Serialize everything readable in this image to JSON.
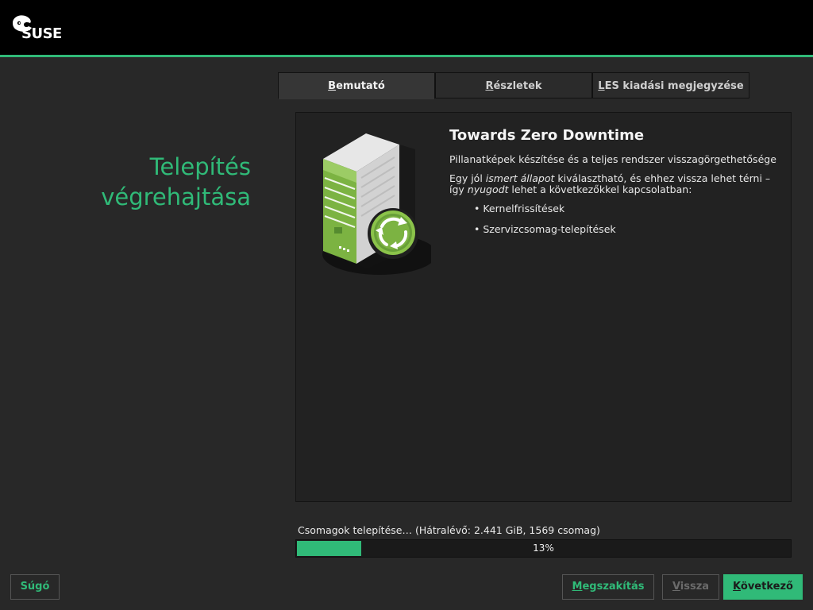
{
  "brand": {
    "logo_text": "SUSE",
    "accent": "#30ba78",
    "header_bg": "#000000"
  },
  "page": {
    "title": "Telepítés\nvégrehajtása"
  },
  "tabs": [
    {
      "mnemonic": "B",
      "rest": "emutató",
      "active": true
    },
    {
      "mnemonic": "R",
      "rest": "észletek",
      "active": false
    },
    {
      "mnemonic": "L",
      "rest": "ES kiadási megjegyzése",
      "active": false
    }
  ],
  "slide": {
    "icon": "server-icon",
    "title": "Towards Zero Downtime",
    "paragraph1": "Pillanatképek készítése és a teljes rendszer visszagörgethetősége",
    "p2_part1": "Egy jól ",
    "p2_em1": "ismert állapot",
    "p2_part2": " kiválasztható, és ehhez vissza lehet térni – így ",
    "p2_em2": "nyugodt",
    "p2_part3": " lehet a következőkkel kapcsolatban:",
    "bullets": [
      "Kernelfrissítések",
      "Szervizcsomag-telepítések"
    ]
  },
  "progress": {
    "label": "Csomagok telepítése… (Hátralévő: 2.441 GiB, 1569 csomag)",
    "percent": 13,
    "percent_text": "13%"
  },
  "buttons": {
    "help": "Súgó",
    "abort_mnemonic": "M",
    "abort_rest": "egszakítás",
    "back_mnemonic": "V",
    "back_rest": "issza",
    "next_mnemonic": "K",
    "next_rest": "övetkező"
  }
}
